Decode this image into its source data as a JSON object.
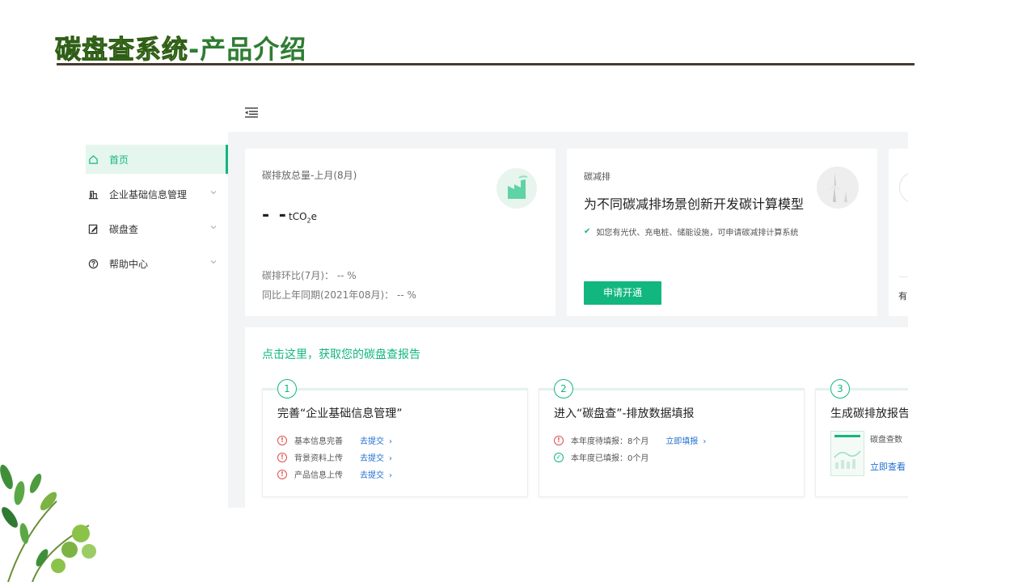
{
  "slide": {
    "title_part1": "碳盘查系统",
    "title_part2": "-产品介绍"
  },
  "sidebar": {
    "items": [
      {
        "label": "首页",
        "icon": "home-icon",
        "active": true
      },
      {
        "label": "企业基础信息管理",
        "icon": "building-icon",
        "active": false
      },
      {
        "label": "碳盘查",
        "icon": "edit-doc-icon",
        "active": false
      },
      {
        "label": "帮助中心",
        "icon": "question-circle-icon",
        "active": false
      }
    ]
  },
  "card_emission": {
    "title": "碳排放总量-上月(8月)",
    "value": "- -",
    "unit_main": "tCO",
    "unit_sub": "2",
    "unit_end": "e",
    "stat_mom": "碳排环比(7月)：  -- %",
    "stat_yoy": "同比上年同期(2021年08月)：  --  %"
  },
  "card_reduction": {
    "label": "碳减排",
    "title": "为不同碳减排场景创新开发碳计算模型",
    "note": "如您有光伏、充电桩、储能设施，可申请碳减排计算系统",
    "button": "申请开通"
  },
  "card_third": {
    "peek_text": "有"
  },
  "report": {
    "title": "点击这里，获取您的碳盘查报告",
    "steps": [
      {
        "num": "1",
        "title": "完善“企业基础信息管理”",
        "rows": [
          {
            "text": "基本信息完善",
            "link": "去提交"
          },
          {
            "text": "背景资料上传",
            "link": "去提交"
          },
          {
            "text": "产品信息上传",
            "link": "去提交"
          }
        ]
      },
      {
        "num": "2",
        "title": "进入“碳盘查”-排放数据填报",
        "rows": [
          {
            "text": "本年度待填报：8个月",
            "link": "立即填报"
          },
          {
            "text": "本年度已填报：0个月",
            "link": ""
          }
        ]
      },
      {
        "num": "3",
        "title": "生成碳排放报告",
        "desc": "碳盘查数",
        "link": "立即查看"
      }
    ]
  },
  "colors": {
    "accent": "#12b77f",
    "link": "#1f6fd1",
    "warn": "#e05050"
  }
}
